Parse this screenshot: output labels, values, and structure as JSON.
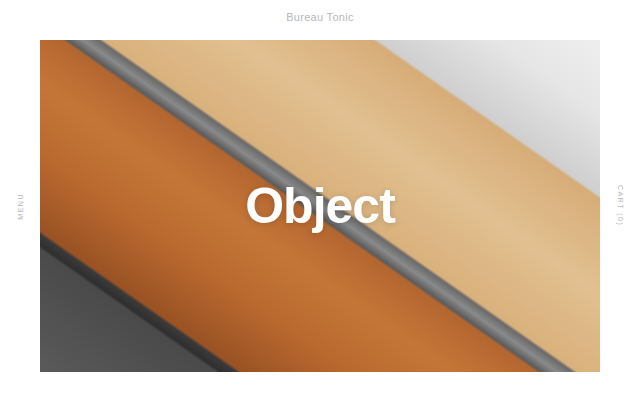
{
  "header": {
    "brand": "Bureau Tonic"
  },
  "nav": {
    "menu": "MENU",
    "cart": "CART (0)"
  },
  "hero": {
    "title": "Object"
  }
}
